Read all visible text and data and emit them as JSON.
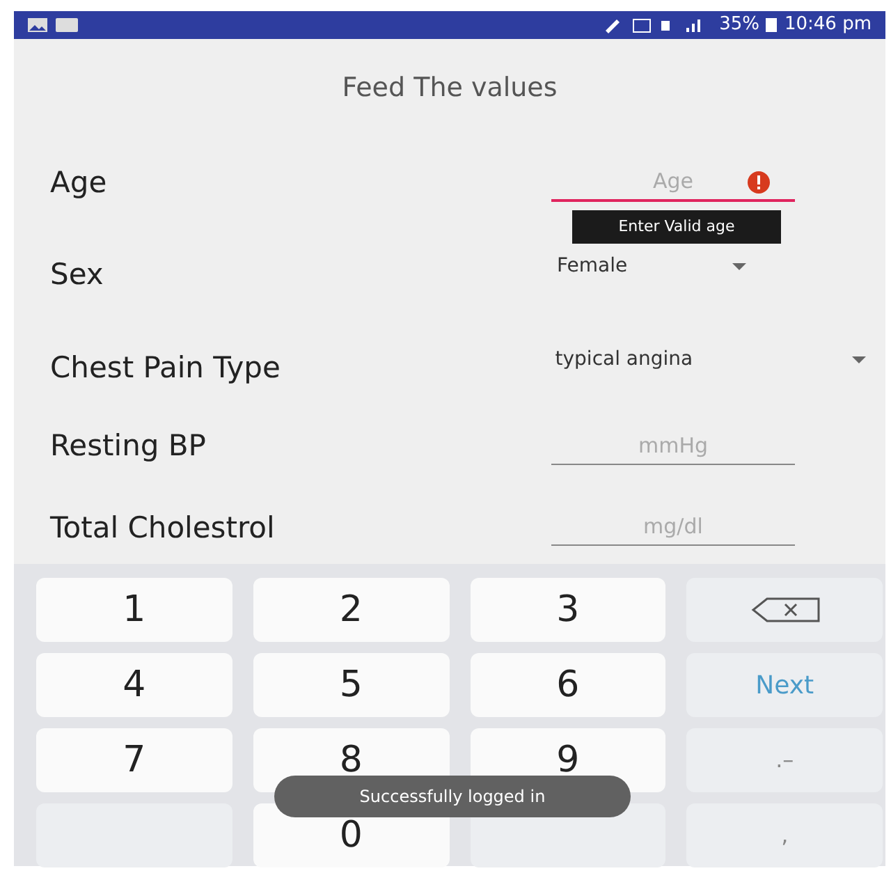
{
  "status_bar": {
    "battery": "35%",
    "time": "10:46 pm"
  },
  "title": "Feed The values",
  "fields": [
    {
      "kind": "text",
      "label": "Age",
      "placeholder": "Age",
      "error": true,
      "error_message": "Enter Valid age"
    },
    {
      "kind": "dropdown",
      "label": "Sex",
      "value": "Female"
    },
    {
      "kind": "dropdown",
      "label": "Chest Pain Type",
      "value": "typical angina"
    },
    {
      "kind": "text",
      "label": "Resting BP",
      "placeholder": "mmHg",
      "error": false
    },
    {
      "kind": "text",
      "label": "Total Cholestrol",
      "placeholder": "mg/dl",
      "error": false
    }
  ],
  "keyboard": [
    {
      "kind": "digit",
      "label": "1"
    },
    {
      "kind": "digit",
      "label": "2"
    },
    {
      "kind": "digit",
      "label": "3"
    },
    {
      "kind": "backspace"
    },
    {
      "kind": "digit",
      "label": "4"
    },
    {
      "kind": "digit",
      "label": "5"
    },
    {
      "kind": "digit",
      "label": "6"
    },
    {
      "kind": "action",
      "label": "Next"
    },
    {
      "kind": "digit",
      "label": "7"
    },
    {
      "kind": "digit",
      "label": "8"
    },
    {
      "kind": "digit",
      "label": "9"
    },
    {
      "kind": "symbol",
      "label": ".–"
    },
    {
      "kind": "empty"
    },
    {
      "kind": "digit",
      "label": "0"
    },
    {
      "kind": "empty"
    },
    {
      "kind": "symbol",
      "label": ","
    }
  ],
  "toast": "Successfully logged in"
}
